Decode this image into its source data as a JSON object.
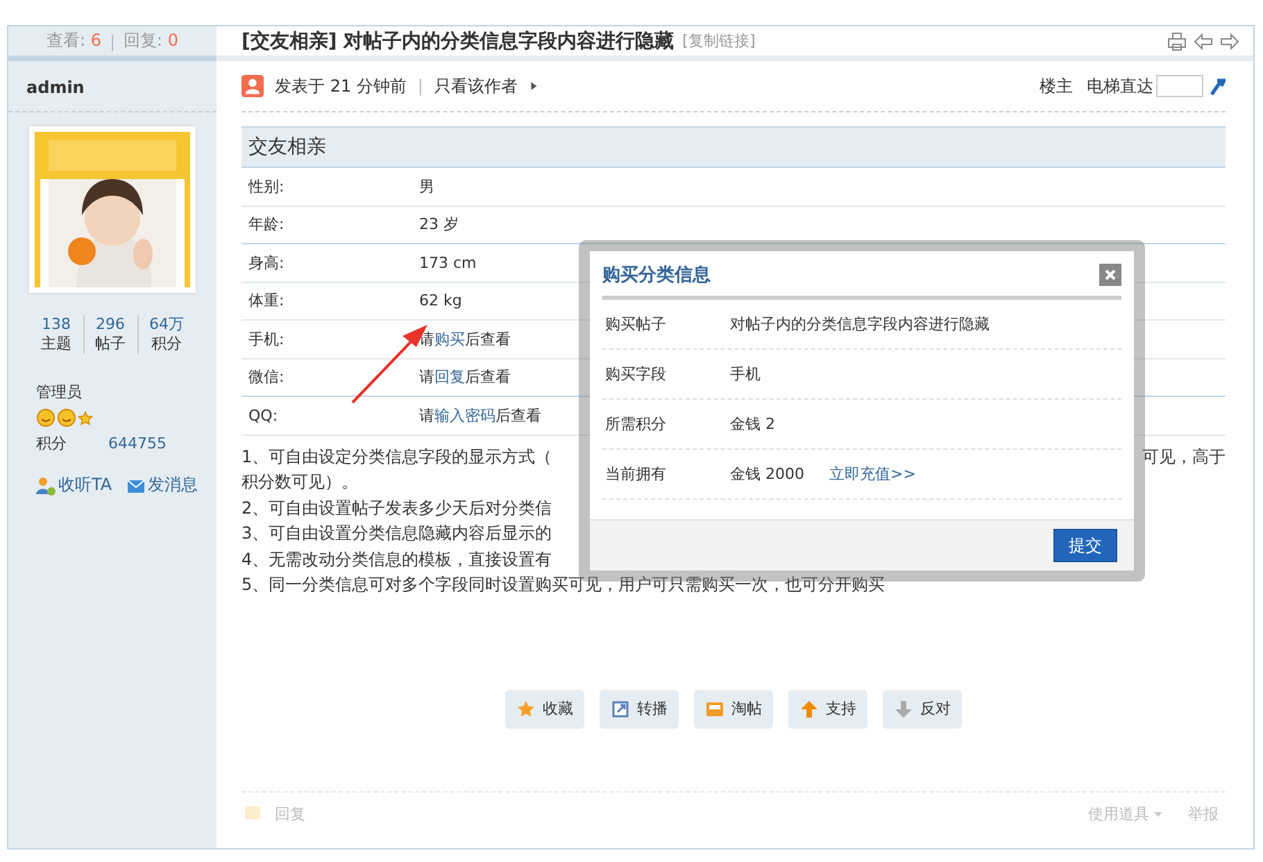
{
  "stats": {
    "views_label": "查看:",
    "views": "6",
    "separator": "|",
    "replies_label": "回复:",
    "replies": "0"
  },
  "thread": {
    "category": "[交友相亲]",
    "title": "对帖子内的分类信息字段内容进行隐藏",
    "copy_link": "[复制链接]"
  },
  "author": {
    "name": "admin",
    "counts": [
      {
        "value": "138",
        "label": "主题"
      },
      {
        "value": "296",
        "label": "帖子"
      },
      {
        "value": "64万",
        "label": "积分"
      }
    ],
    "group": "管理员",
    "points_label": "积分",
    "points": "644755",
    "follow": "收听TA",
    "message": "发消息"
  },
  "post_bar": {
    "posted": "发表于 21 分钟前",
    "separator": "|",
    "only_author": "只看该作者",
    "floor": "楼主",
    "jump_label": "电梯直达"
  },
  "info_table": {
    "title": "交友相亲",
    "rows": [
      {
        "label": "性别:",
        "value": "男"
      },
      {
        "label": "年龄:",
        "value": "23 岁"
      },
      {
        "label": "身高:",
        "value": "173 cm"
      },
      {
        "label": "体重:",
        "value": "62 kg"
      },
      {
        "label": "手机:",
        "before": "请",
        "link": "购买",
        "after": "后查看"
      },
      {
        "label": "微信:",
        "before": "请",
        "link": "回复",
        "after": "后查看"
      },
      {
        "label": "QQ:",
        "before": "请",
        "link": "输入密码",
        "after": "后查看"
      }
    ]
  },
  "notes": [
    {
      "left": "1、可自由设定分类信息字段的显示方式（",
      "right": "可见，高于"
    },
    {
      "left": "积分数可见）。"
    },
    {
      "left": "2、可自由设置帖子发表多少天后对分类信"
    },
    {
      "left": "3、可自由设置分类信息隐藏内容后显示的"
    },
    {
      "left": "4、无需改动分类信息的模板，直接设置有"
    },
    {
      "left": "5、同一分类信息可对多个字段同时设置购买可见，用户可只需购买一次，也可分开购买"
    }
  ],
  "actions": [
    {
      "kind": "star",
      "label": "收藏"
    },
    {
      "kind": "share",
      "label": "转播"
    },
    {
      "kind": "tray",
      "label": "淘帖"
    },
    {
      "kind": "up",
      "label": "支持"
    },
    {
      "kind": "down",
      "label": "反对"
    }
  ],
  "footer": {
    "reply": "回复",
    "tools": "使用道具",
    "report": "举报"
  },
  "dialog": {
    "title": "购买分类信息",
    "rows": [
      {
        "label": "购买帖子",
        "value": "对帖子内的分类信息字段内容进行隐藏"
      },
      {
        "label": "购买字段",
        "value": "手机"
      },
      {
        "label": "所需积分",
        "value": "金钱 2"
      },
      {
        "label": "当前拥有",
        "value": "金钱 2000",
        "link": "立即充值>>"
      }
    ],
    "submit": "提交"
  }
}
